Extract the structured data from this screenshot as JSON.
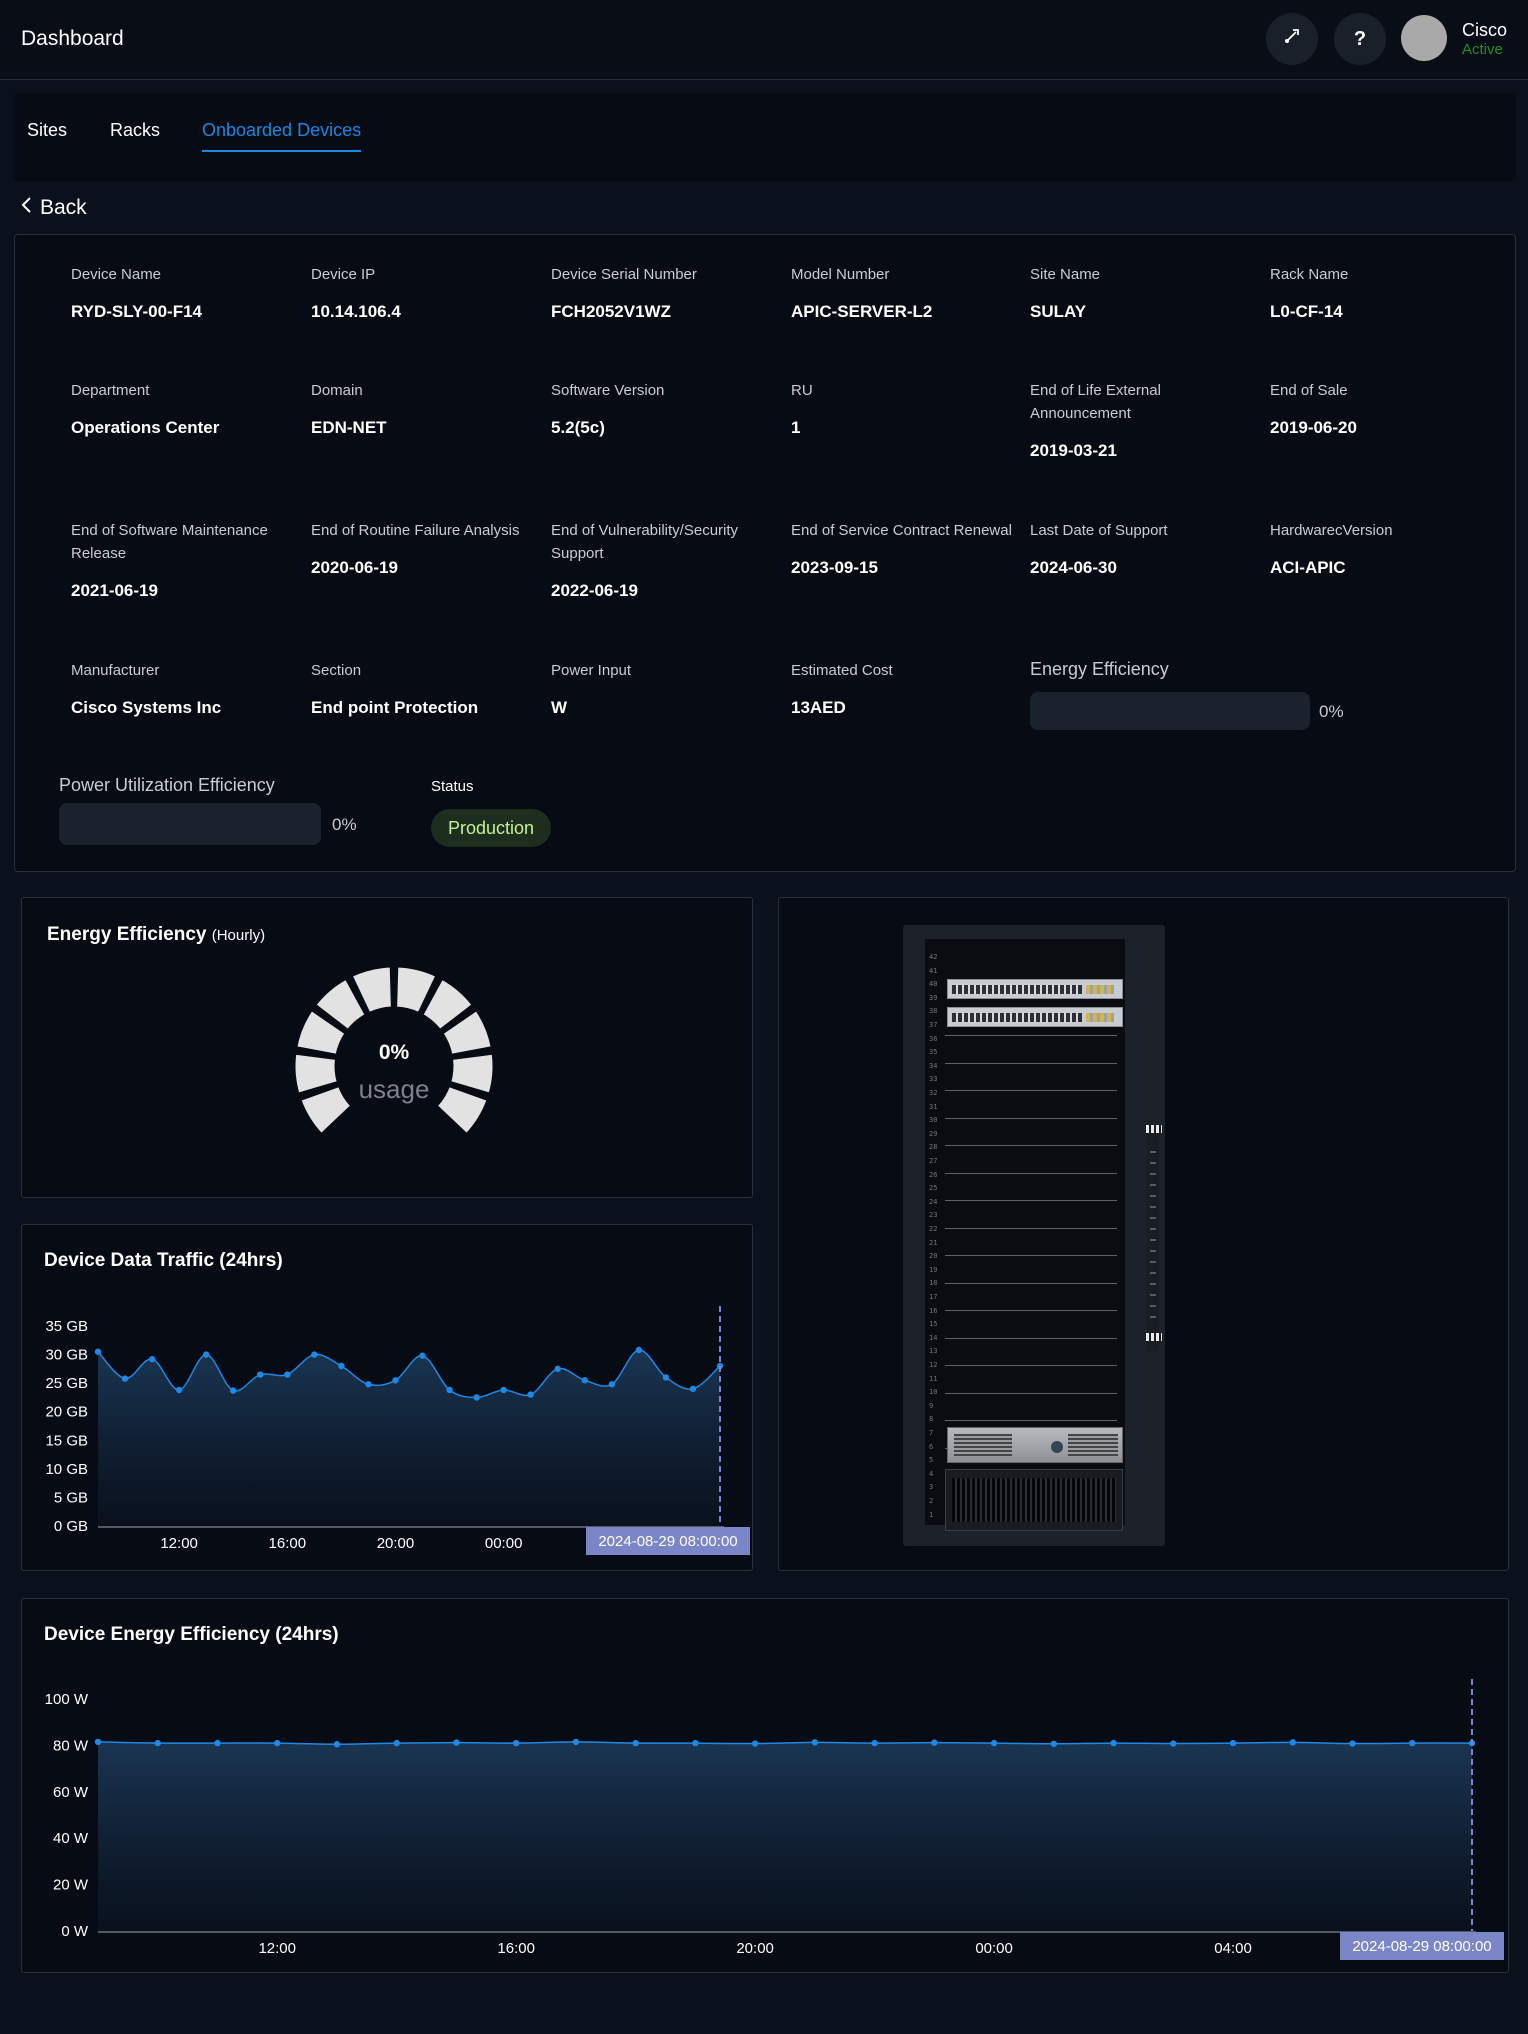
{
  "topbar": {
    "title": "Dashboard",
    "icons": {
      "launch": "rocket-icon",
      "help": "help-icon"
    },
    "help_label": "?",
    "user": {
      "name": "Cisco",
      "status": "Active"
    }
  },
  "tabs": [
    {
      "label": "Sites",
      "active": false
    },
    {
      "label": "Racks",
      "active": false
    },
    {
      "label": "Onboarded Devices",
      "active": true
    }
  ],
  "back_label": "Back",
  "device": {
    "fields": [
      {
        "label": "Device Name",
        "value": "RYD-SLY-00-F14"
      },
      {
        "label": "Device IP",
        "value": "10.14.106.4"
      },
      {
        "label": "Device Serial Number",
        "value": "FCH2052V1WZ"
      },
      {
        "label": "Model Number",
        "value": "APIC-SERVER-L2"
      },
      {
        "label": "Site Name",
        "value": "SULAY"
      },
      {
        "label": "Rack Name",
        "value": "L0-CF-14"
      },
      {
        "label": "Department",
        "value": "Operations Center"
      },
      {
        "label": "Domain",
        "value": "EDN-NET"
      },
      {
        "label": "Software Version",
        "value": "5.2(5c)"
      },
      {
        "label": "RU",
        "value": "1"
      },
      {
        "label": "End of Life External Announcement",
        "value": "2019-03-21"
      },
      {
        "label": "End of Sale",
        "value": "2019-06-20"
      },
      {
        "label": "End of Software Maintenance Release",
        "value": "2021-06-19"
      },
      {
        "label": "End of Routine Failure Analysis",
        "value": "2020-06-19"
      },
      {
        "label": "End of Vulnerability/Security Support",
        "value": "2022-06-19"
      },
      {
        "label": "End of Service Contract Renewal",
        "value": "2023-09-15"
      },
      {
        "label": "Last Date of Support",
        "value": "2024-06-30"
      },
      {
        "label": "HardwarecVersion",
        "value": "ACI-APIC"
      },
      {
        "label": "Manufacturer",
        "value": "Cisco Systems Inc"
      },
      {
        "label": "Section",
        "value": "End point Protection"
      },
      {
        "label": "Power Input",
        "value": "W"
      },
      {
        "label": "Estimated Cost",
        "value": "13AED"
      }
    ],
    "energy_efficiency": {
      "label": "Energy Efficiency",
      "percent_text": "0%",
      "fraction": 0
    },
    "power_utilization": {
      "label": "Power Utilization Efficiency",
      "percent_text": "0%",
      "fraction": 0
    },
    "status": {
      "label": "Status",
      "value": "Production"
    }
  },
  "energy_gauge": {
    "title": "Energy Efficiency",
    "subtitle": "(Hourly)",
    "value_text": "0%",
    "caption": "usage",
    "fraction": 0
  },
  "colors": {
    "accent": "#1b87e6",
    "line": "#1e88e5",
    "tooltip_bg": "#7b86c8",
    "status_bg": "#1d2e1f",
    "status_text": "#c3f28e",
    "active_user": "#2a8a2a"
  },
  "rack_view": {
    "units": 42
  },
  "chart_data": [
    {
      "type": "area",
      "title": "Device Data Traffic (24hrs)",
      "xlabel": "",
      "ylabel": "",
      "x_tick_labels": [
        "12:00",
        "16:00",
        "20:00",
        "00:00"
      ],
      "y_tick_labels": [
        "0 GB",
        "5 GB",
        "10 GB",
        "15 GB",
        "20 GB",
        "25 GB",
        "30 GB",
        "35 GB"
      ],
      "ylim": [
        0,
        35
      ],
      "series": [
        {
          "values": [
            30.5,
            25.8,
            29.2,
            23.8,
            30,
            23.7,
            26.5,
            26.5,
            30,
            28,
            24.8,
            25.5,
            29.8,
            23.8,
            22.5,
            23.8,
            23,
            27.5,
            25.5,
            24.8,
            30.8,
            26,
            24,
            28
          ]
        }
      ],
      "hover_label": "2024-08-29 08:00:00",
      "grid": false
    },
    {
      "type": "area",
      "title": "Device Energy Efficiency (24hrs)",
      "xlabel": "",
      "ylabel": "",
      "x_tick_labels": [
        "12:00",
        "16:00",
        "20:00",
        "00:00",
        "04:00"
      ],
      "y_tick_labels": [
        "0 W",
        "20 W",
        "40 W",
        "60 W",
        "80 W",
        "100 W"
      ],
      "ylim": [
        0,
        100
      ],
      "series": [
        {
          "values": [
            81.5,
            81,
            81,
            81,
            80.5,
            81,
            81.2,
            81,
            81.5,
            81,
            81,
            80.8,
            81.3,
            81,
            81.2,
            81,
            80.7,
            81,
            80.8,
            81,
            81.3,
            80.8,
            81,
            81
          ]
        }
      ],
      "hover_label": "2024-08-29 08:00:00",
      "grid": false
    }
  ]
}
